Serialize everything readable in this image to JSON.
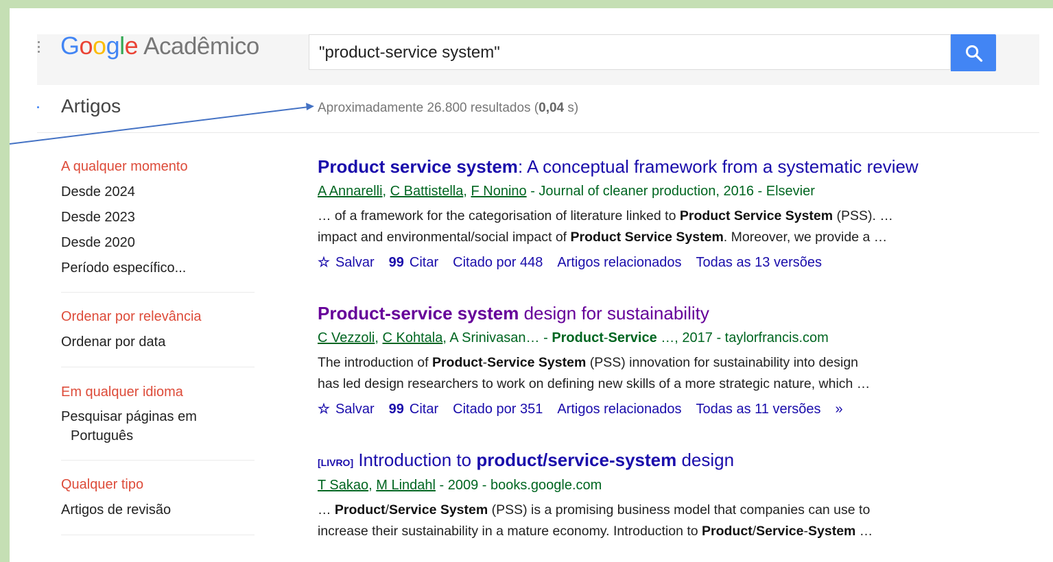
{
  "header": {
    "logo_letters": [
      "G",
      "o",
      "o",
      "g",
      "l",
      "e"
    ],
    "logo_suffix": "Acadêmico",
    "search_value": "\"product-service system\""
  },
  "subbar": {
    "section": "Artigos",
    "results_prefix": "Aproximadamente 26.800 resultados (",
    "results_time": "0,04",
    "results_suffix": " s)"
  },
  "sidebar": {
    "time": [
      "A qualquer momento",
      "Desde 2024",
      "Desde 2023",
      "Desde 2020",
      "Período específico..."
    ],
    "sort": [
      "Ordenar por relevância",
      "Ordenar por data"
    ],
    "lang": [
      "Em qualquer idioma",
      "Pesquisar páginas em",
      "Português"
    ],
    "type": [
      "Qualquer tipo",
      "Artigos de revisão"
    ]
  },
  "results": [
    {
      "title_bold": "Product service system",
      "title_rest": ": A conceptual framework from a systematic review",
      "authors": [
        "A Annarelli",
        "C Battistella",
        "F Nonino"
      ],
      "source": " - Journal of cleaner production, 2016 - Elsevier",
      "snippet1": [
        "… of a framework for the categorisation of literature linked to ",
        "Product Service System",
        " (PSS). …"
      ],
      "snippet2": [
        "impact and environmental/social impact of ",
        "Product Service System",
        ". Moreover, we provide a …"
      ],
      "actions": {
        "save": "Salvar",
        "cite": "Citar",
        "cited": "Citado por 448",
        "related": "Artigos relacionados",
        "versions": "Todas as 13 versões"
      }
    },
    {
      "title_bold": "Product-service system",
      "title_rest": " design for sustainability",
      "authors": [
        "C Vezzoli",
        "C Kohtala"
      ],
      "authors_more": ", A Srinivasan… - ",
      "source_bold": "Product",
      "source_bold2": "Service",
      "source": " …, 2017 - taylorfrancis.com",
      "snippet1": [
        "The introduction of ",
        "Product",
        "-",
        "Service System",
        " (PSS) innovation for sustainability into design"
      ],
      "snippet2": [
        "has led design researchers to work on defining new skills of a more strategic nature, which …"
      ],
      "actions": {
        "save": "Salvar",
        "cite": "Citar",
        "cited": "Citado por 351",
        "related": "Artigos relacionados",
        "versions": "Todas as 11 versões"
      }
    },
    {
      "tag": "[LIVRO]",
      "title_pre": " Introduction to ",
      "title_bold": "product/service-system",
      "title_rest": " design",
      "authors": [
        "T Sakao",
        "M Lindahl"
      ],
      "source": " - 2009 - books.google.com",
      "snippet1": [
        "… ",
        "Product",
        "/",
        "Service System",
        " (PSS) is a promising business model that companies can use to"
      ],
      "snippet2": [
        "increase their sustainability in a mature economy. Introduction to ",
        "Product",
        "/",
        "Service",
        "-",
        "System",
        " …"
      ]
    }
  ]
}
